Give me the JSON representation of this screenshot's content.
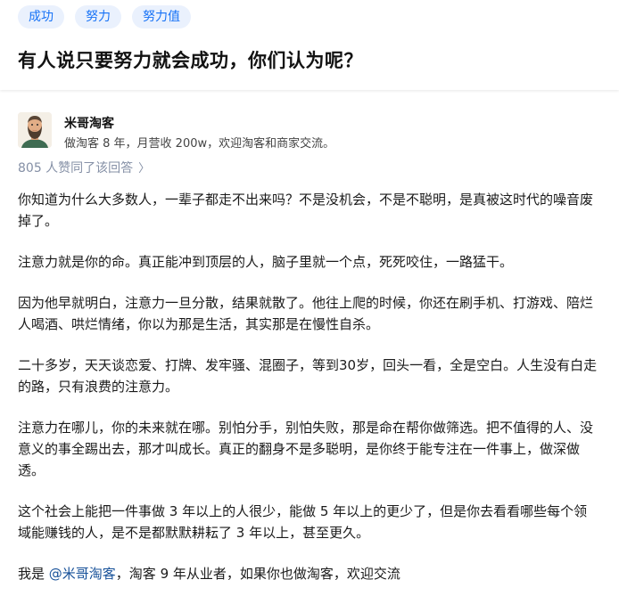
{
  "tags": [
    "成功",
    "努力",
    "努力值"
  ],
  "question": {
    "title": "有人说只要努力就会成功，你们认为呢？"
  },
  "author": {
    "name": "米哥淘客",
    "bio": "做淘客 8 年，月营收 200w，欢迎淘客和商家交流。"
  },
  "upvotes": {
    "text": "805 人赞同了该回答",
    "chevron": "〉"
  },
  "answer": {
    "paragraphs": [
      "你知道为什么大多数人，一辈子都走不出来吗？不是没机会，不是不聪明，是真被这时代的噪音废掉了。",
      "注意力就是你的命。真正能冲到顶层的人，脑子里就一个点，死死咬住，一路猛干。",
      "因为他早就明白，注意力一旦分散，结果就散了。他往上爬的时候，你还在刷手机、打游戏、陪烂人喝酒、哄烂情绪，你以为那是生活，其实那是在慢性自杀。",
      "二十多岁，天天谈恋爱、打牌、发牢骚、混圈子，等到30岁，回头一看，全是空白。人生没有白走的路，只有浪费的注意力。",
      "注意力在哪儿，你的未来就在哪。别怕分手，别怕失败，那是命在帮你做筛选。把不值得的人、没意义的事全踢出去，那才叫成长。真正的翻身不是多聪明，是你终于能专注在一件事上，做深做透。",
      "这个社会上能把一件事做 3 年以上的人很少，能做 5 年以上的更少了，但是你去看看哪些每个领域能赚钱的人，是不是都默默耕耘了 3 年以上，甚至更久。"
    ],
    "closing": {
      "prefix": "我是 ",
      "mention": "@米哥淘客",
      "suffix": "，淘客 9 年从业者，如果你也做淘客，欢迎交流"
    }
  },
  "colors": {
    "accent": "#1772f6",
    "tag_bg": "#eaf1fd",
    "muted": "#8590a6",
    "link": "#175199"
  },
  "icons": {
    "avatar": "bearded-man-avatar",
    "chevron": "chevron-right-icon"
  }
}
